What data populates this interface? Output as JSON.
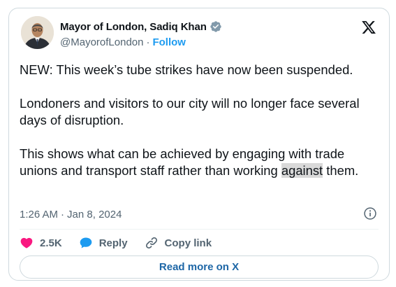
{
  "author": {
    "name": "Mayor of London, Sadiq Khan",
    "handle": "@MayorofLondon",
    "separator": "·",
    "follow_label": "Follow"
  },
  "tweet": {
    "line1": "NEW: This week’s tube strikes have now been suspended.",
    "line2": "Londoners and visitors to our city will no longer face several days of disruption.",
    "line3_before": "This shows what can be achieved by engaging with trade unions and transport staff rather than working ",
    "line3_highlight": "against",
    "line3_after": " them."
  },
  "meta": {
    "time": "1:26 AM",
    "separator": "·",
    "date": "Jan 8, 2024"
  },
  "actions": {
    "likes": "2.5K",
    "reply": "Reply",
    "copy_link": "Copy link"
  },
  "read_more": "Read more on X",
  "colors": {
    "accent": "#1d9bf0",
    "like": "#f91880",
    "reply_bubble": "#1d9bf0",
    "read_more_text": "#1d66a6",
    "secondary_text": "#536471",
    "border": "#cfd9de"
  },
  "icons": {
    "verified": "verified-badge-icon",
    "x_logo": "x-logo-icon",
    "info": "info-icon",
    "like": "heart-icon",
    "reply": "reply-bubble-icon",
    "copy": "link-icon"
  }
}
